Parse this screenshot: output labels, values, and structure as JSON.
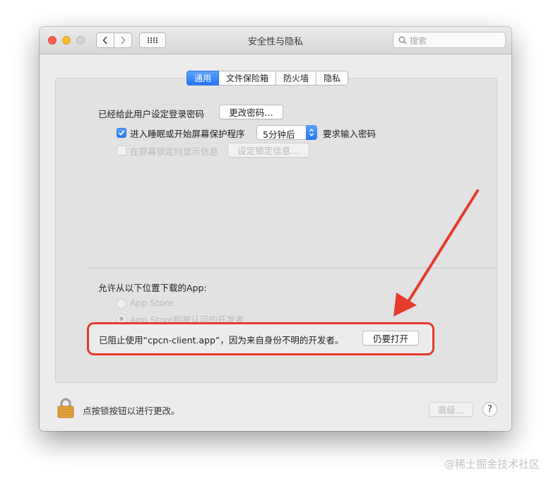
{
  "window": {
    "title": "安全性与隐私",
    "search_placeholder": "搜索"
  },
  "tabs": [
    {
      "label": "通用",
      "active": true
    },
    {
      "label": "文件保险箱",
      "active": false
    },
    {
      "label": "防火墙",
      "active": false
    },
    {
      "label": "隐私",
      "active": false
    }
  ],
  "general": {
    "password_label": "已经给此用户设定登录密码",
    "change_password_button": "更改密码…",
    "require_password_checked": true,
    "require_password_label": "进入睡眠或开始屏幕保护程序",
    "require_password_delay": "5分钟后",
    "require_password_suffix": "要求输入密码",
    "show_message_checked": false,
    "show_message_label": "在屏幕锁定时显示信息",
    "set_lock_message_button": "设定锁定信息…",
    "allow_download_label": "允许从以下位置下载的App:",
    "option_app_store": "App Store",
    "option_app_store_identified": "App Store和被认可的开发者",
    "selected_option": "App Store和被认可的开发者",
    "blocked_message": "已阻止使用“cpcn-client.app”，因为来自身份不明的开发者。",
    "open_anyway_button": "仍要打开"
  },
  "footer": {
    "lock_text": "点按锁按钮以进行更改。",
    "advanced_button": "高级…",
    "help_button": "?"
  },
  "watermark": "@稀土掘金技术社区",
  "colors": {
    "accent": "#2577f5",
    "annotation": "#e43b2b"
  }
}
